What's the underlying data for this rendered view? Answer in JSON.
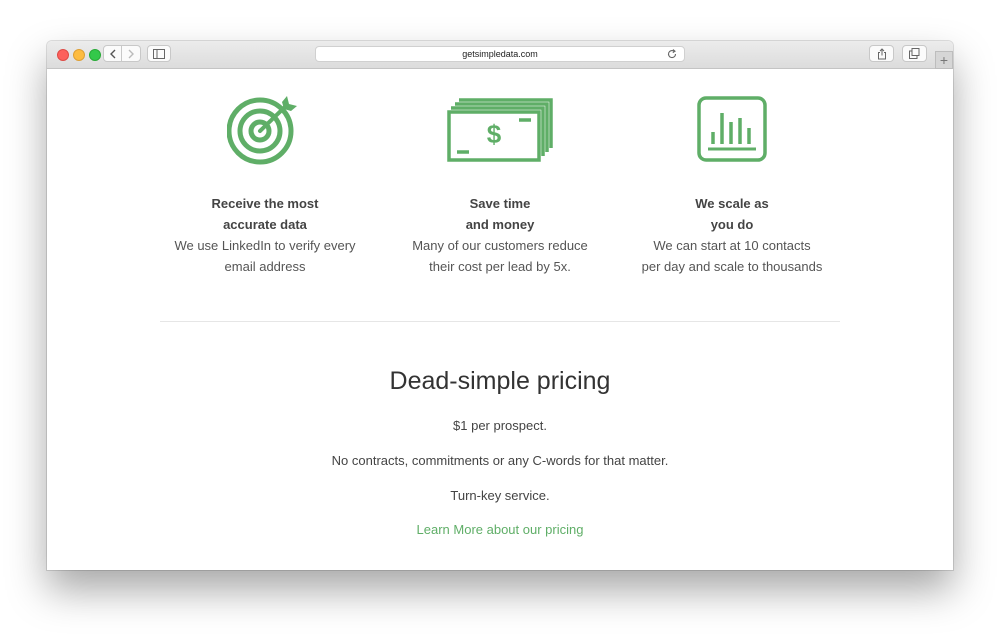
{
  "browser": {
    "url": "getsimpledata.com",
    "new_tab_symbol": "+"
  },
  "features": [
    {
      "icon": "target-icon",
      "title_lines": [
        "Receive the most",
        "accurate data"
      ],
      "desc_lines": [
        "We use LinkedIn to verify every",
        "email address"
      ]
    },
    {
      "icon": "money-icon",
      "title_lines": [
        "Save time",
        "and money"
      ],
      "desc_lines": [
        "Many of our customers reduce",
        "their cost per lead by 5x."
      ]
    },
    {
      "icon": "bar-chart-icon",
      "title_lines": [
        "We scale as",
        "you do"
      ],
      "desc_lines": [
        "We can start at 10 contacts",
        "per day and scale to thousands"
      ]
    }
  ],
  "pricing": {
    "title": "Dead-simple pricing",
    "line1": "$1 per prospect.",
    "line2": "No contracts, commitments or any C-words for that matter.",
    "line3": "Turn-key service.",
    "link": "Learn More about our pricing"
  },
  "colors": {
    "accent": "#5fae67",
    "text": "#555555"
  }
}
